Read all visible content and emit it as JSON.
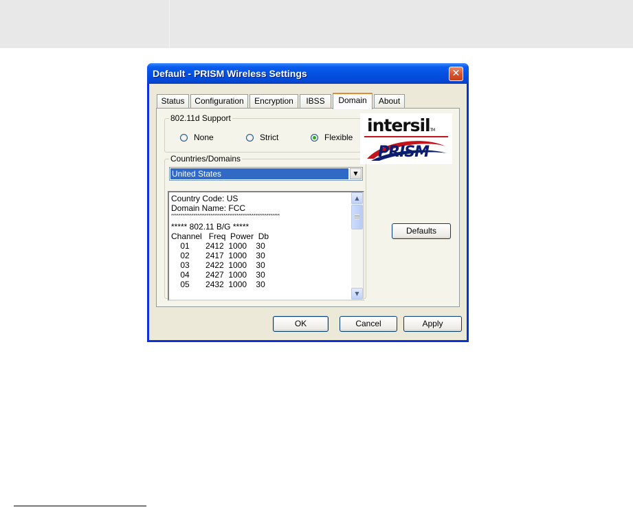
{
  "window": {
    "title": "Default - PRISM Wireless Settings",
    "close_glyph": "✕"
  },
  "tabs": [
    {
      "label": "Status"
    },
    {
      "label": "Configuration"
    },
    {
      "label": "Encryption"
    },
    {
      "label": "IBSS"
    },
    {
      "label": "Domain",
      "active": true
    },
    {
      "label": "About"
    }
  ],
  "support_group": {
    "label": "802.11d Support",
    "options": [
      {
        "label": "None",
        "selected": false
      },
      {
        "label": "Strict",
        "selected": false
      },
      {
        "label": "Flexible",
        "selected": true
      }
    ]
  },
  "countries_group": {
    "label": "Countries/Domains",
    "selected": "United States",
    "details": [
      "Country Code: US",
      "Domain Name: FCC",
      "**********************************************************",
      "***** 802.11 B/G *****",
      "Channel   Freq  Power  Db",
      "    01       2412  1000    30",
      "    02       2417  1000    30",
      "    03       2422  1000    30",
      "    04       2427  1000    30",
      "    05       2432  1000    30"
    ]
  },
  "logo": {
    "brand_top": "intersil",
    "brand_tm": "TM",
    "brand_bottom": "PRISM"
  },
  "buttons": {
    "defaults": "Defaults",
    "ok": "OK",
    "cancel": "Cancel",
    "apply": "Apply"
  },
  "icons": {
    "scroll_up": "chevron-up-icon",
    "scroll_down": "chevron-down-icon",
    "dropdown": "triangle-down-icon"
  },
  "colors": {
    "title_blue": "#0551e0",
    "selection": "#316ac5",
    "tab_accent": "#e68b2c",
    "close_red": "#d4522c"
  }
}
